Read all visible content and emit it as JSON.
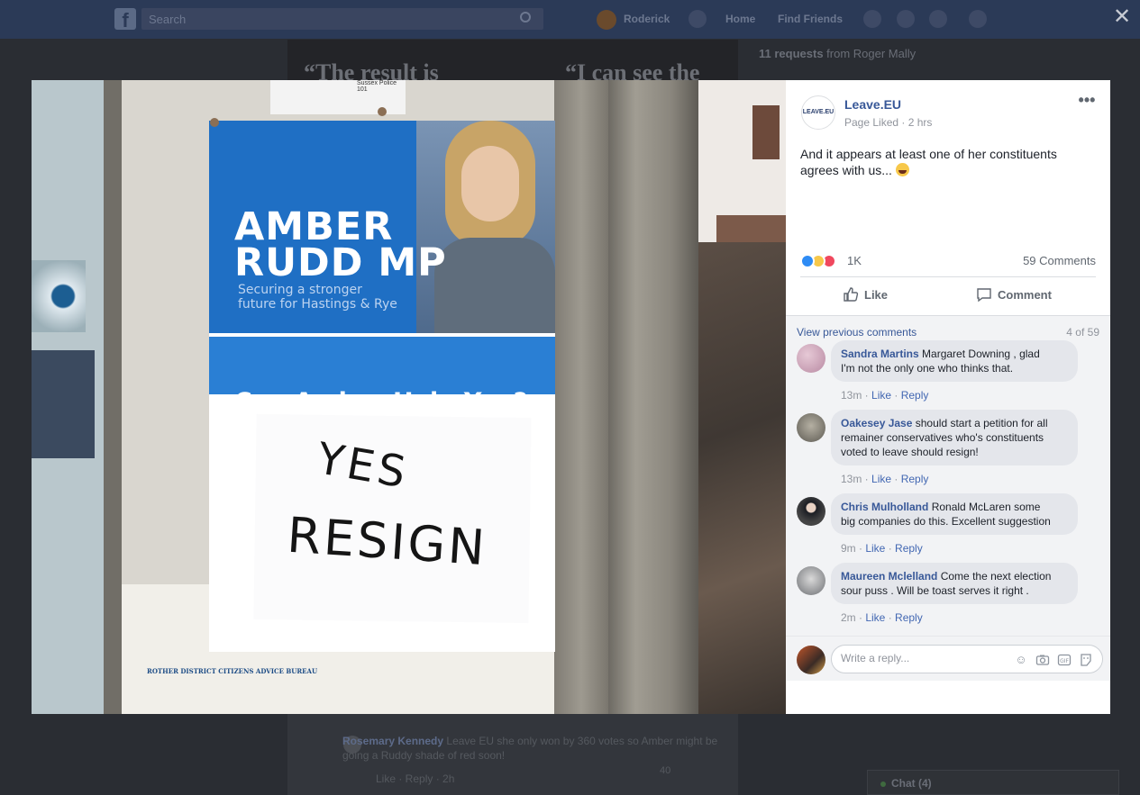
{
  "topbar": {
    "search_placeholder": "Search",
    "profile_name": "Roderick",
    "nav_home": "Home",
    "nav_find_friends": "Find Friends"
  },
  "close_label": "✕",
  "background": {
    "banner_quote_left": "“The result is",
    "banner_quote_right": "“I can see the",
    "right_col": {
      "requests_count": "11 requests",
      "requests_from": "from Roger Mally"
    },
    "comment": {
      "author": "Rosemary Kennedy",
      "text": "Leave EU she only won by 360 votes so Amber might be going a Ruddy shade of red soon!",
      "actions": "Like · Reply · 2h",
      "reaction_count": "40"
    },
    "chat": "Chat (4)"
  },
  "photo": {
    "poster_name_line1": "AMBER",
    "poster_name_line2": "RUDD MP",
    "poster_tagline_line1": "Securing a stronger",
    "poster_tagline_line2": "future for Hastings & Rye",
    "poster_help": "Can Amber Help You?",
    "poster_header": "Sussex Police 101",
    "sign_line1": "YES",
    "sign_line2": "RESIGN",
    "notice_text": "ROTHER DISTRICT CITIZENS ADVICE BUREAU"
  },
  "post": {
    "page_logo_text": "LEAVE.EU",
    "page_name": "Leave.EU",
    "meta": "Page Liked · 2 hrs",
    "text": "And it appears at least one of her constituents agrees with us...",
    "reaction_count": "1K",
    "comments_count": "59 Comments",
    "like_label": "Like",
    "comment_label": "Comment",
    "view_previous": "View previous comments",
    "pager": "4 of 59",
    "comments": [
      {
        "author": "Sandra Martins",
        "text_line1": "Margaret Downing , glad",
        "text_line2": "I'm not the only one who thinks that.",
        "time": "13m",
        "like": "Like",
        "reply": "Reply",
        "avatar_color": "#c9a0b8"
      },
      {
        "author": "Oakesey Jase",
        "text_line1": "should start a petition for all",
        "text_line2": "remainer conservatives who's constituents",
        "text_line3": "voted to leave should resign!",
        "time": "13m",
        "like": "Like",
        "reply": "Reply",
        "avatar_color": "#7d7a70"
      },
      {
        "author": "Chris Mulholland",
        "text_line1": "Ronald McLaren some",
        "text_line2": "big companies do this. Excellent suggestion",
        "time": "9m",
        "like": "Like",
        "reply": "Reply",
        "avatar_color": "#2d2f35"
      },
      {
        "author": "Maureen Mclelland",
        "text_line1": "Come the next election",
        "text_line2": "sour puss . Will be toast serves it right .",
        "time": "2m",
        "like": "Like",
        "reply": "Reply",
        "avatar_color": "#8a8c90"
      }
    ],
    "reply_placeholder": "Write a reply..."
  },
  "colors": {
    "accent_link": "#385898",
    "like_blue": "#2e8cf5",
    "love_red": "#f0485e",
    "haha_yellow": "#f7c84a"
  }
}
